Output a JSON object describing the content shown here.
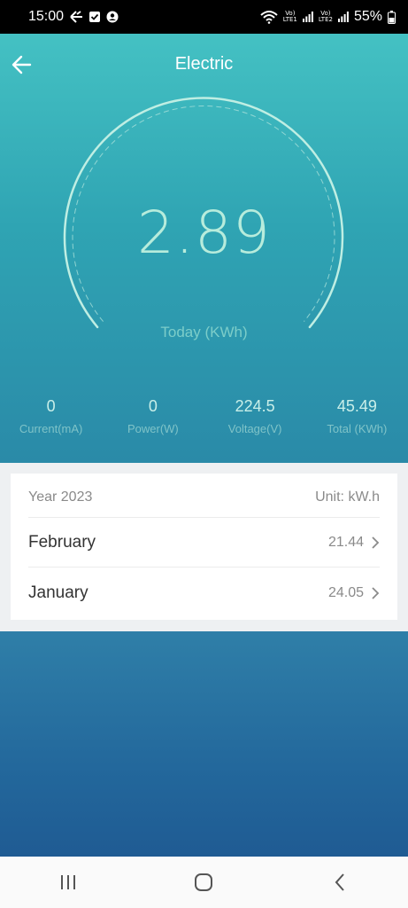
{
  "status_bar": {
    "time": "15:00",
    "battery_percent": "55%",
    "sim1_top": "Vo)",
    "sim1_bottom": "LTE1",
    "sim2_top": "Vo)",
    "sim2_bottom": "LTE2",
    "icons": [
      "tailscale-icon",
      "checkbox-notification-icon",
      "account-icon",
      "wifi-icon",
      "signal-icon",
      "battery-icon"
    ]
  },
  "header": {
    "title": "Electric"
  },
  "gauge": {
    "value": "2.89",
    "label": "Today (KWh)"
  },
  "stats": [
    {
      "value": "0",
      "label": "Current(mA)"
    },
    {
      "value": "0",
      "label": "Power(W)"
    },
    {
      "value": "224.5",
      "label": "Voltage(V)"
    },
    {
      "value": "45.49",
      "label": "Total (KWh)"
    }
  ],
  "history": {
    "year_label": "Year 2023",
    "unit_label": "Unit: kW.h",
    "rows": [
      {
        "month": "February",
        "value": "21.44"
      },
      {
        "month": "January",
        "value": "24.05"
      }
    ]
  },
  "colors": {
    "accent_top": "#44c1c3",
    "accent_bottom": "#1f5b93",
    "gauge_value": "#b7ecdc"
  }
}
